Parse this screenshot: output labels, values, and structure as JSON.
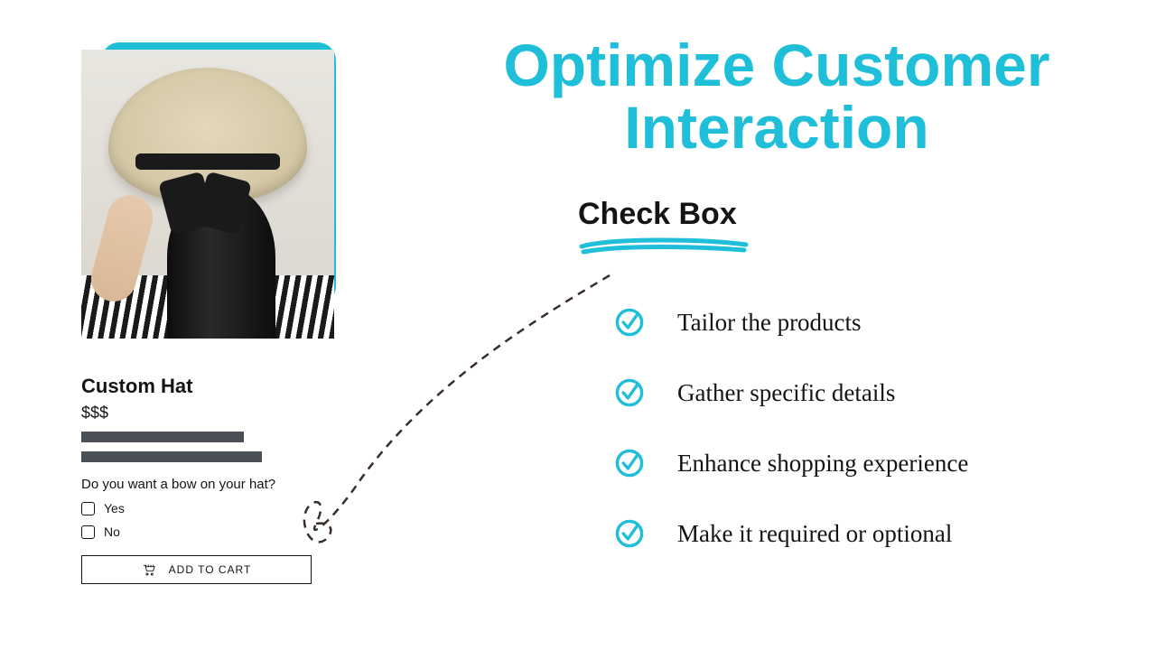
{
  "product": {
    "title": "Custom Hat",
    "price": "$$$",
    "question": "Do you want a bow on your hat?",
    "option_yes": "Yes",
    "option_no": "No",
    "add_to_cart": "ADD TO CART"
  },
  "headline": "Optimize Customer Interaction",
  "subhead": "Check Box",
  "benefits": [
    "Tailor the products",
    "Gather specific details",
    "Enhance shopping experience",
    "Make it required or optional"
  ],
  "colors": {
    "accent": "#20bfd9",
    "text": "#141414"
  }
}
